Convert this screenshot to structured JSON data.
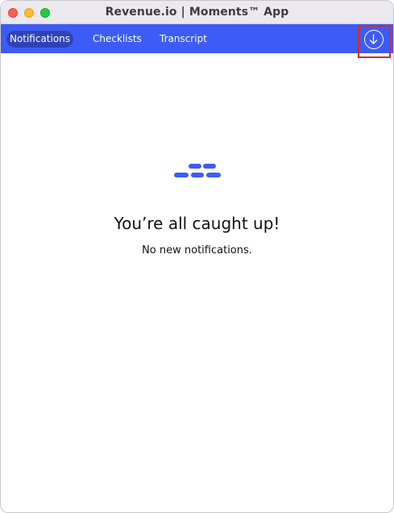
{
  "window": {
    "title": "Revenue.io | Moments™ App"
  },
  "navbar": {
    "tabs": [
      {
        "label": "Notifications",
        "active": true
      },
      {
        "label": "Checklists",
        "active": false
      },
      {
        "label": "Transcript",
        "active": false
      }
    ],
    "download_icon": "arrow-down-circle-icon"
  },
  "empty_state": {
    "icon": "dashes-icon",
    "heading": "You’re all caught up!",
    "message": "No new notifications."
  },
  "colors": {
    "accent": "#3d5cf5",
    "active_tab": "#2e43b8",
    "highlight": "#e0252b"
  }
}
